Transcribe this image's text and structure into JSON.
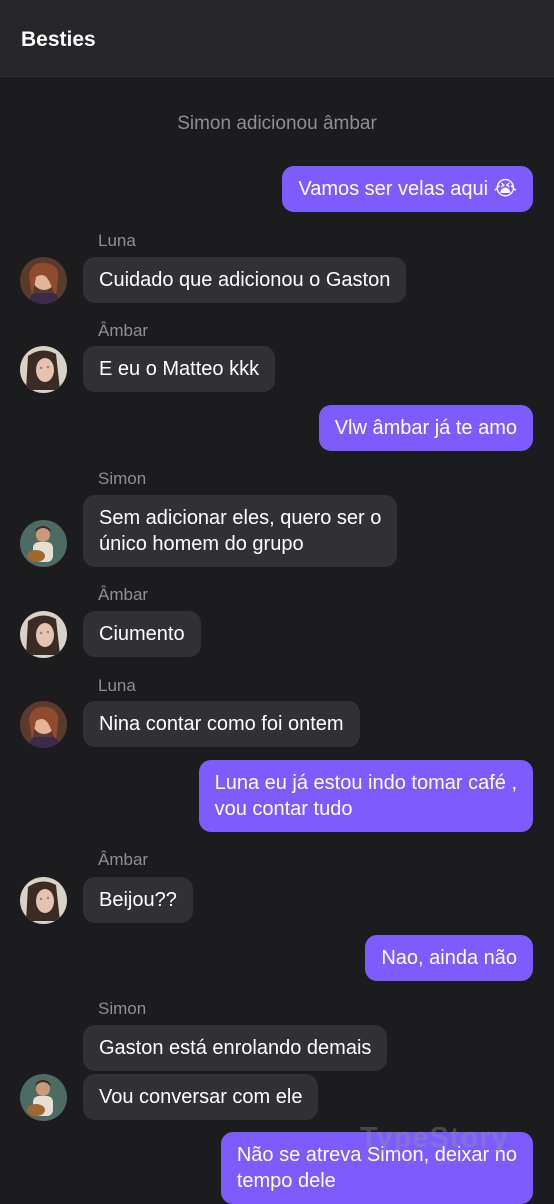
{
  "header": {
    "title": "Besties"
  },
  "system_message": "Simon adicionou âmbar",
  "messages": [
    {
      "dir": "out",
      "text": "Vamos ser velas aqui 😭"
    },
    {
      "dir": "in",
      "sender": "Luna",
      "avatar": "avatar-luna",
      "text": "Cuidado que adicionou o Gaston"
    },
    {
      "dir": "in",
      "sender": "Âmbar",
      "avatar": "avatar-ambar",
      "text": "E eu o Matteo kkk"
    },
    {
      "dir": "out",
      "text": "Vlw âmbar já te amo"
    },
    {
      "dir": "in",
      "sender": "Simon",
      "avatar": "avatar-simon",
      "text": "Sem adicionar eles, quero ser o\núnico homem do grupo"
    },
    {
      "dir": "in",
      "sender": "Âmbar",
      "avatar": "avatar-ambar",
      "text": "Ciumento"
    },
    {
      "dir": "in",
      "sender": "Luna",
      "avatar": "avatar-luna",
      "text": "Nina contar como foi ontem"
    },
    {
      "dir": "out",
      "text": "Luna eu já estou indo tomar café ,\nvou contar tudo"
    },
    {
      "dir": "in",
      "sender": "Âmbar",
      "avatar": "avatar-ambar",
      "text": "Beijou??"
    },
    {
      "dir": "out",
      "text": "Nao, ainda não"
    },
    {
      "dir": "in",
      "sender": "Simon",
      "avatar": "avatar-simon",
      "text": "Gaston está enrolando demais"
    },
    {
      "dir": "in",
      "avatar": "avatar-simon",
      "text": "Vou conversar com ele"
    },
    {
      "dir": "out",
      "text": "Não se atreva Simon, deixar no\ntempo dele"
    }
  ],
  "watermark": "TypeStory",
  "colors": {
    "background": "#1c1c1e",
    "header": "#262628",
    "incoming_bubble": "#313133",
    "outgoing_bubble": "#7c5cff",
    "meta_text": "#8e8e93"
  }
}
